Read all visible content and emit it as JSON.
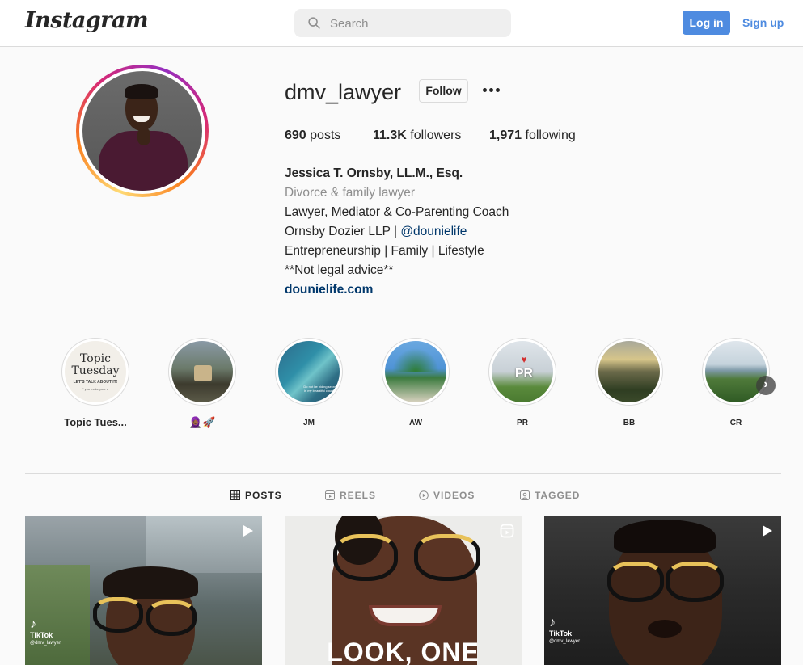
{
  "header": {
    "logo": "Instagram",
    "search_placeholder": "Search",
    "login_label": "Log in",
    "signup_label": "Sign up"
  },
  "profile": {
    "username": "dmv_lawyer",
    "follow_label": "Follow",
    "stats": {
      "posts_count": "690",
      "posts_label": "posts",
      "followers_count": "11.3K",
      "followers_label": "followers",
      "following_count": "1,971",
      "following_label": "following"
    },
    "bio": {
      "full_name": "Jessica T. Ornsby, LL.M., Esq.",
      "category": "Divorce & family lawyer",
      "line1": "Lawyer, Mediator & Co-Parenting Coach",
      "line2_prefix": "Ornsby Dozier LLP | ",
      "line2_mention": "@dounielife",
      "line3": "Entrepreneurship | Family | Lifestyle",
      "line4": "**Not legal advice**",
      "link": "dounielife.com"
    }
  },
  "highlights": [
    {
      "label": "Topic Tues...",
      "cover_title_1": "Topic",
      "cover_title_2": "Tuesday",
      "cover_sub": "LET'S TALK ABOUT IT!",
      "cover_sub2": "\" you make your c"
    },
    {
      "label": "🧕🏾🚀"
    },
    {
      "label": "JM",
      "cover_text": "Do not be hiding secret in my beautiful country"
    },
    {
      "label": "AW"
    },
    {
      "label": "PR",
      "cover_text": "PR"
    },
    {
      "label": "BB"
    },
    {
      "label": "CR"
    }
  ],
  "tabs": [
    {
      "label": "POSTS",
      "icon": "grid-icon",
      "active": true
    },
    {
      "label": "REELS",
      "icon": "reels-icon",
      "active": false
    },
    {
      "label": "VIDEOS",
      "icon": "play-circle-icon",
      "active": false
    },
    {
      "label": "TAGGED",
      "icon": "tag-icon",
      "active": false
    }
  ],
  "posts": [
    {
      "type": "video",
      "badge": "TikTok",
      "badge_user": "@dmv_lawyer"
    },
    {
      "type": "reel",
      "overlay_text": "LOOK, ONE"
    },
    {
      "type": "video",
      "badge": "TikTok",
      "badge_user": "@dmv_lawyer"
    }
  ],
  "colors": {
    "accent": "#4e8be0",
    "link": "#00376b",
    "muted": "#8e8e8e",
    "border": "#dbdbdb"
  }
}
